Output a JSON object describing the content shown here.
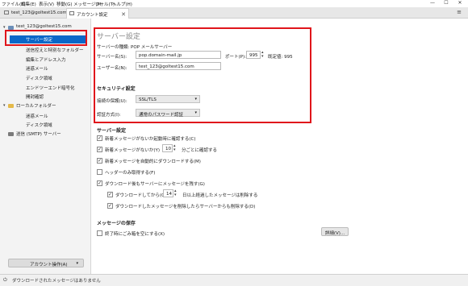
{
  "menubar": {
    "items": [
      "ファイル(F)",
      "編集(E)",
      "表示(V)",
      "移動(G)",
      "メッセージ(M)",
      "ツール(T)",
      "ヘルプ(H)"
    ],
    "controls": [
      "—",
      "☐",
      "✕"
    ]
  },
  "tabs": {
    "inactive_label": "test_123@goltest15.com",
    "active_label": "アカウント設定",
    "close_glyph": "✕",
    "menu_glyph": "≡"
  },
  "sidebar": {
    "account": "test_123@goltest15.com",
    "items": [
      "サーバー設定",
      "送信控えと特別なフォルダー",
      "編集とアドレス入力",
      "迷惑メール",
      "ディスク領域",
      "エンドツーエンド暗号化",
      "開封確認"
    ],
    "local_folders": "ローカルフォルダー",
    "local_items": [
      "迷惑メール",
      "ディスク領域"
    ],
    "smtp": "送信 (SMTP) サーバー",
    "account_actions": "アカウント操作(A)"
  },
  "main": {
    "title": "サーバー設定",
    "server_type": "サーバーの種類: POP メールサーバー",
    "server_name_label": "サーバー名(S):",
    "server_name_value": "pop.domain-mail.jp",
    "port_label": "ポート(P):",
    "port_value": "995",
    "port_default": "既定値: 995",
    "username_label": "ユーザー名(N):",
    "username_value": "test_123@goltest15.com",
    "security_heading": "セキュリティ設定",
    "connection_security_label": "接続の保護(U):",
    "connection_security_value": "SSL/TLS",
    "auth_method_label": "認証方式(I):",
    "auth_method_value": "通常のパスワード認証",
    "server_settings_heading": "サーバー設定",
    "options": [
      {
        "label": "新着メッセージがないか起動時に確認する(C)",
        "checked": true
      },
      {
        "label": "新着メッセージがないか(Y)",
        "checked": true,
        "minutes": "10",
        "suffix": "分ごとに確認する"
      },
      {
        "label": "新着メッセージを自動的にダウンロードする(M)",
        "checked": true
      },
      {
        "label": "ヘッダーのみ取得する(F)",
        "checked": false
      },
      {
        "label": "ダウンロード後もサーバーにメッセージを残す(G)",
        "checked": true
      }
    ],
    "sub_options": [
      {
        "label": "ダウンロードしてから(O)",
        "checked": true,
        "days": "14",
        "suffix": "日以上経過したメッセージは削除する"
      },
      {
        "label": "ダウンロードしたメッセージを削除したらサーバーからも削除する(D)",
        "checked": true
      }
    ],
    "storage_heading": "メッセージの保存",
    "empty_trash_label": "終了時にごみ箱を空にする(X)",
    "advanced_button": "詳細(V)..."
  },
  "statusbar": {
    "text": "ダウンロードされたメッセージはありません"
  },
  "colors": {
    "selection": "#0a67c8",
    "highlight": "#e0151b"
  }
}
